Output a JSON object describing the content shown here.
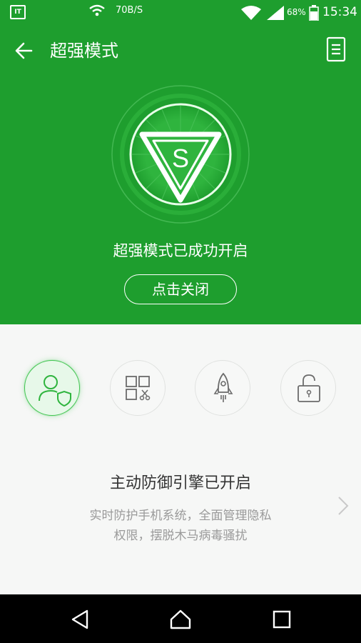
{
  "status_bar": {
    "notification_icon_text": "IT",
    "net_speed": "70B/S",
    "battery_percent": "68%",
    "time": "15:34"
  },
  "header": {
    "title": "超强模式",
    "hero_letter": "S",
    "status": "超强模式已成功开启",
    "close_button": "点击关闭"
  },
  "features": {
    "items": [
      {
        "icon": "user-shield-icon",
        "active": true
      },
      {
        "icon": "app-manage-icon",
        "active": false
      },
      {
        "icon": "rocket-icon",
        "active": false
      },
      {
        "icon": "unlock-icon",
        "active": false
      }
    ],
    "title": "主动防御引擎已开启",
    "description_line1": "实时防护手机系统，全面管理隐私",
    "description_line2": "权限，摆脱木马病毒骚扰"
  },
  "colors": {
    "brand_green": "#1e9e2e",
    "active_green": "#43c653"
  }
}
